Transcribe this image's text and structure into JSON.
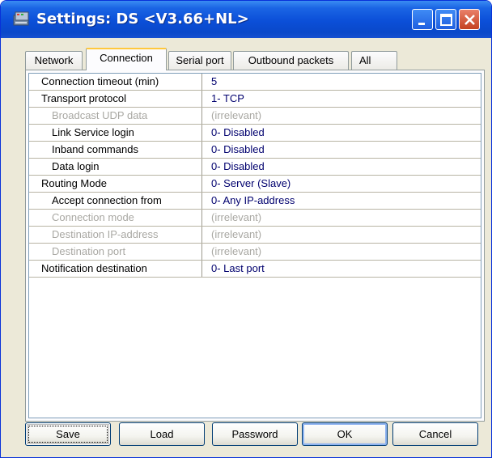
{
  "window": {
    "title": "Settings: DS <V3.66+NL>",
    "colors": {
      "titlebar": "#0b4fd8",
      "face": "#ece9d8",
      "value_text": "#00006e",
      "disabled_text": "#a9a8a3",
      "active_tab_accent": "#ffc83c"
    }
  },
  "titlebar_buttons": {
    "minimize_icon": "minimize-icon",
    "maximize_icon": "maximize-icon",
    "close_icon": "close-icon"
  },
  "tabs": [
    {
      "label": "Network"
    },
    {
      "label": "Connection"
    },
    {
      "label": "Serial port"
    },
    {
      "label": "Outbound packets"
    },
    {
      "label": "All"
    }
  ],
  "active_tab": "Connection",
  "settings": [
    {
      "name": "Connection timeout (min)",
      "value": "5",
      "level": 0,
      "disabled": false
    },
    {
      "name": "Transport protocol",
      "value": "1- TCP",
      "level": 0,
      "disabled": false
    },
    {
      "name": "Broadcast UDP data",
      "value": "(irrelevant)",
      "level": 1,
      "disabled": true
    },
    {
      "name": "Link Service login",
      "value": "0- Disabled",
      "level": 1,
      "disabled": false
    },
    {
      "name": "Inband commands",
      "value": "0- Disabled",
      "level": 1,
      "disabled": false
    },
    {
      "name": "Data login",
      "value": "0- Disabled",
      "level": 1,
      "disabled": false
    },
    {
      "name": "Routing Mode",
      "value": "0- Server (Slave)",
      "level": 0,
      "disabled": false
    },
    {
      "name": "Accept connection from",
      "value": "0- Any IP-address",
      "level": 1,
      "disabled": false
    },
    {
      "name": "Connection mode",
      "value": "(irrelevant)",
      "level": 1,
      "disabled": true
    },
    {
      "name": "Destination IP-address",
      "value": "(irrelevant)",
      "level": 1,
      "disabled": true
    },
    {
      "name": "Destination port",
      "value": "(irrelevant)",
      "level": 1,
      "disabled": true
    },
    {
      "name": "Notification destination",
      "value": "0- Last port",
      "level": 0,
      "disabled": false
    }
  ],
  "buttons": {
    "save": "Save",
    "load": "Load",
    "password": "Password",
    "ok": "OK",
    "cancel": "Cancel"
  }
}
